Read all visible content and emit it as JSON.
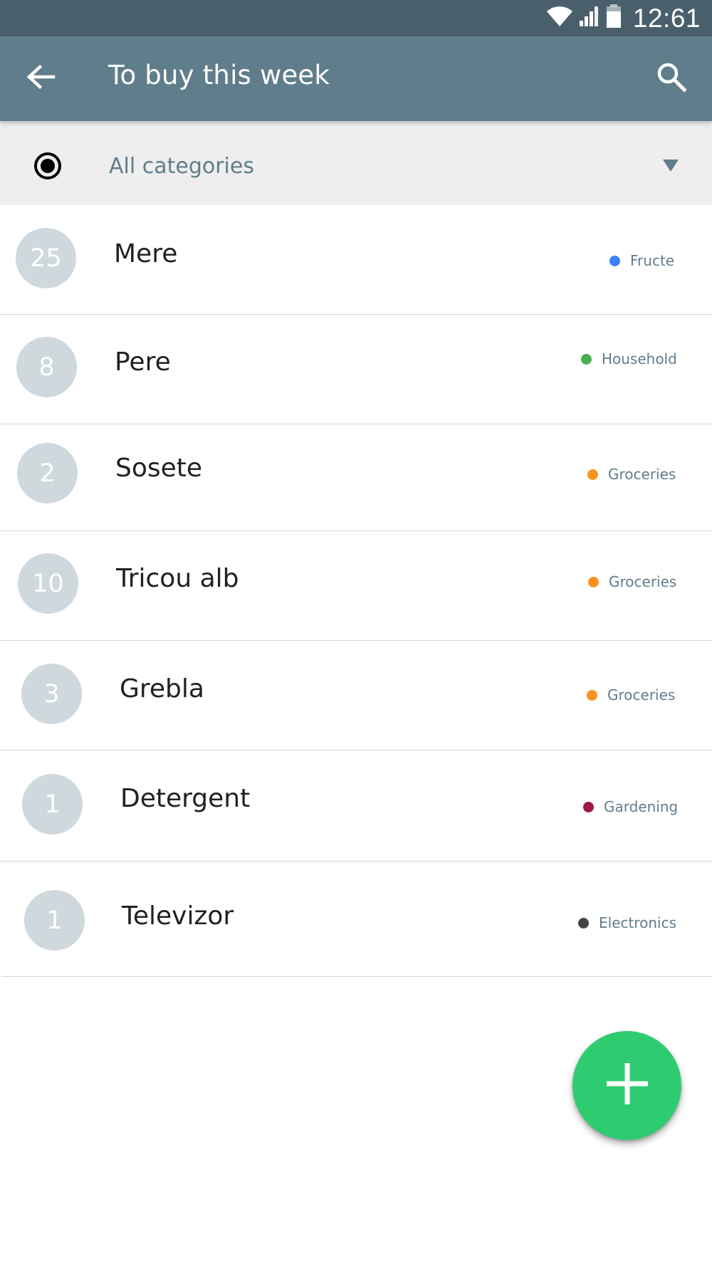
{
  "status_bar": {
    "time": "12:61",
    "icons": [
      "wifi-icon",
      "signal-icon",
      "battery-icon"
    ]
  },
  "app_bar": {
    "title": "To buy this week",
    "back_icon": "arrow-left-icon",
    "search_icon": "search-icon"
  },
  "filter": {
    "label": "All categories",
    "selected": true
  },
  "items": [
    {
      "quantity": "25",
      "name": "Mere",
      "category": "Fructe",
      "color": "#3b82f6"
    },
    {
      "quantity": "8",
      "name": "Pere",
      "category": "Household",
      "color": "#4caf50"
    },
    {
      "quantity": "2",
      "name": "Sosete",
      "category": "Groceries",
      "color": "#f7931e"
    },
    {
      "quantity": "10",
      "name": "Tricou alb",
      "category": "Groceries",
      "color": "#f7931e"
    },
    {
      "quantity": "3",
      "name": "Grebla",
      "category": "Groceries",
      "color": "#f7931e"
    },
    {
      "quantity": "1",
      "name": "Detergent",
      "category": "Gardening",
      "color": "#9c1747"
    },
    {
      "quantity": "1",
      "name": "Televizor",
      "category": "Electronics",
      "color": "#444444"
    }
  ],
  "fab": {
    "icon": "plus-icon"
  },
  "colors": {
    "status_bar": "#4a5f6c",
    "app_bar": "#607d8b",
    "filter_bar": "#eeeeee",
    "qty_circle": "#cfd8dc",
    "fab": "#2ecc71"
  }
}
